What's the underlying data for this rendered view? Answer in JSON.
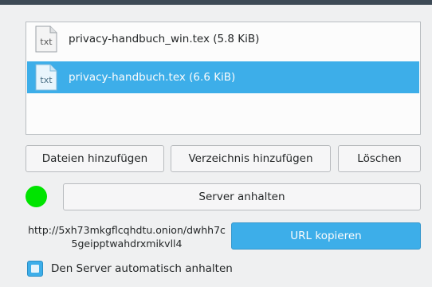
{
  "files": [
    {
      "label": "privacy-handbuch_win.tex (5.8 KiB)",
      "icon": "text-file-icon",
      "selected": false
    },
    {
      "label": "privacy-handbuch.tex (6.6 KiB)",
      "icon": "text-file-icon",
      "selected": true
    }
  ],
  "buttons": {
    "add_files": "Dateien hinzufügen",
    "add_folder": "Verzeichnis hinzufügen",
    "delete": "Löschen",
    "stop_server": "Server anhalten",
    "copy_url": "URL kopieren"
  },
  "server": {
    "status_color": "#00e400",
    "url": "http://5xh73mkgflcqhdtu.onion/dwhh7c5geipptwahdrxmikvll4"
  },
  "auto_stop": {
    "label": "Den Server automatisch anhalten",
    "checked": true
  },
  "colors": {
    "accent": "#3daee9",
    "status_running": "#00e400"
  }
}
